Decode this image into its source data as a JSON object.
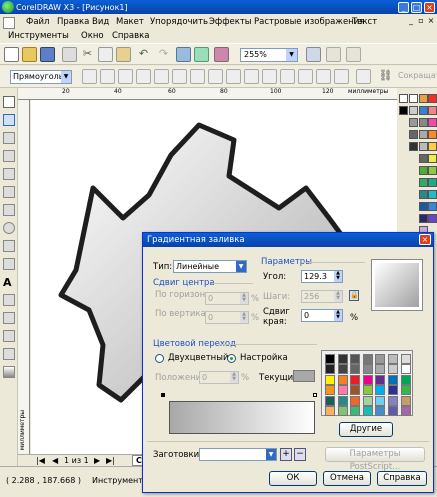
{
  "window": {
    "title": "CorelDRAW X3 - [Рисунок1]"
  },
  "menu": {
    "row1": [
      "Файл",
      "Правка",
      "Вид",
      "Макет",
      "Упорядочить",
      "Эффекты",
      "Растровые изображения",
      "Текст"
    ],
    "row2": [
      "Инструменты",
      "Окно",
      "Справка"
    ]
  },
  "toolbar": {
    "zoom": "255%"
  },
  "property_bar": {
    "shape": "Прямоуголь...",
    "sokr": "Сокращат"
  },
  "ruler": {
    "top_marks": [
      "20",
      "40",
      "60",
      "80",
      "100",
      "120"
    ],
    "units": "миллиметры",
    "left_units": "миллиметры"
  },
  "page_nav": {
    "text": "1 из 1",
    "tab": "Стр"
  },
  "status": {
    "coords": "( 2.288 , 187.668 )",
    "tool": "Инструмент с двой"
  },
  "dialog": {
    "title": "Градиентная заливка",
    "type_label": "Тип:",
    "type_value": "Линейные",
    "center_group": "Сдвиг центра",
    "horiz_label": "По горизонтали:",
    "horiz_value": "0",
    "vert_label": "По вертикали:",
    "vert_value": "0",
    "params_group": "Параметры",
    "angle_label": "Угол:",
    "angle_value": "129.3",
    "steps_label": "Шаги:",
    "steps_value": "256",
    "edge_label1": "Сдвиг",
    "edge_label2": "края:",
    "edge_value": "0",
    "pct": "%",
    "color_group": "Цветовой переход",
    "radio_two": "Двухцветный",
    "radio_custom": "Настройка",
    "position_label": "Положение:",
    "position_value": "0",
    "current_label": "Текущий:",
    "other_button": "Другие",
    "presets_label": "Заготовки:",
    "postscript_button": "Параметры PostScript...",
    "ok": "ОК",
    "cancel": "Отмена",
    "help": "Справка",
    "current_color": "#a8a8a8"
  }
}
